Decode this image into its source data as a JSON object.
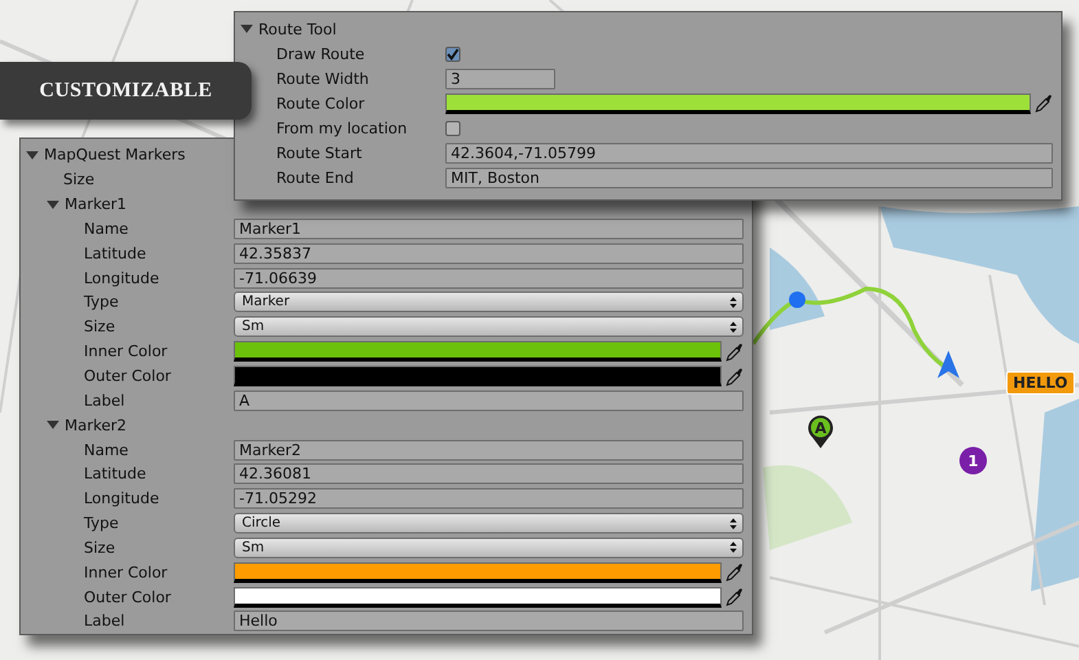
{
  "banner": {
    "text": "CUSTOMIZABLE"
  },
  "route_tool": {
    "title": "Route Tool",
    "expanded": true,
    "fields": [
      {
        "label": "Draw Route",
        "kind": "checkbox",
        "checked": true
      },
      {
        "label": "Route Width",
        "kind": "short",
        "value": "3"
      },
      {
        "label": "Route Color",
        "kind": "color",
        "color": "#9de03a"
      },
      {
        "label": "From my location",
        "kind": "checkbox",
        "checked": false
      },
      {
        "label": "Route Start",
        "kind": "text",
        "value": "42.3604,-71.05799"
      },
      {
        "label": "Route End",
        "kind": "text",
        "value": "MIT, Boston"
      }
    ]
  },
  "markers_panel": {
    "title": "MapQuest Markers",
    "expanded": true,
    "size_label": "Size",
    "markers": [
      {
        "title": "Marker1",
        "expanded": true,
        "fields": [
          {
            "label": "Name",
            "kind": "text",
            "value": "Marker1"
          },
          {
            "label": "Latitude",
            "kind": "text",
            "value": "42.35837"
          },
          {
            "label": "Longitude",
            "kind": "text",
            "value": "-71.06639"
          },
          {
            "label": "Type",
            "kind": "dropdown",
            "value": "Marker"
          },
          {
            "label": "Size",
            "kind": "dropdown",
            "value": "Sm"
          },
          {
            "label": "Inner Color",
            "kind": "color",
            "color": "#6cc10a"
          },
          {
            "label": "Outer Color",
            "kind": "color",
            "color": "#000000"
          },
          {
            "label": "Label",
            "kind": "text",
            "value": "A"
          }
        ]
      },
      {
        "title": "Marker2",
        "expanded": true,
        "fields": [
          {
            "label": "Name",
            "kind": "text",
            "value": "Marker2"
          },
          {
            "label": "Latitude",
            "kind": "text",
            "value": "42.36081"
          },
          {
            "label": "Longitude",
            "kind": "text",
            "value": "-71.05292"
          },
          {
            "label": "Type",
            "kind": "dropdown",
            "value": "Circle"
          },
          {
            "label": "Size",
            "kind": "dropdown",
            "value": "Sm"
          },
          {
            "label": "Inner Color",
            "kind": "color",
            "color": "#ff9c00"
          },
          {
            "label": "Outer Color",
            "kind": "color",
            "color": "#ffffff"
          },
          {
            "label": "Label",
            "kind": "text",
            "value": "Hello"
          }
        ]
      }
    ]
  },
  "map": {
    "markers": [
      {
        "kind": "pin",
        "label": "A",
        "color": "#6abf1e"
      },
      {
        "kind": "circle",
        "label": "1",
        "color": "#7a1fa8"
      },
      {
        "kind": "tag",
        "label": "HELLO",
        "color": "#f29a0c"
      }
    ]
  }
}
